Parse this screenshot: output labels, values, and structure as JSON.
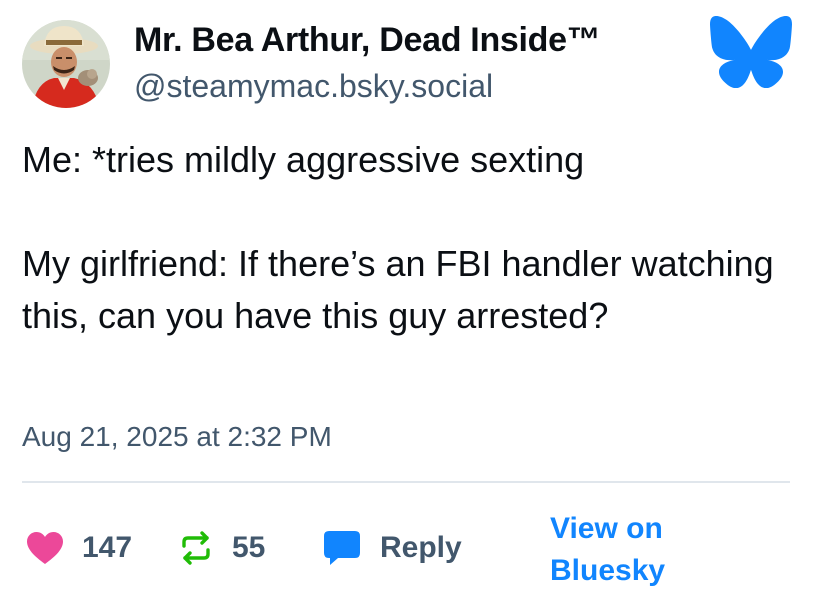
{
  "author": {
    "display_name": "Mr. Bea Arthur, Dead Inside™",
    "handle": "@steamymac.bsky.social",
    "avatar_icon": "profile-photo-avatar"
  },
  "brand": {
    "logo_icon": "bluesky-butterfly-icon",
    "color": "#1185fe"
  },
  "post": {
    "text": "Me: *tries mildly aggressive sexting\n\nMy girlfriend: If there’s an FBI handler watching this, can you have this guy arrested?",
    "timestamp": "Aug 21, 2025 at 2:32 PM"
  },
  "actions": {
    "likes": {
      "icon": "heart-icon",
      "count": "147",
      "color": "#ec4899"
    },
    "reposts": {
      "icon": "repost-icon",
      "count": "55",
      "color": "#20bc07"
    },
    "reply": {
      "icon": "reply-bubble-icon",
      "label": "Reply",
      "color": "#1185fe"
    },
    "view_link": "View on Bluesky"
  }
}
